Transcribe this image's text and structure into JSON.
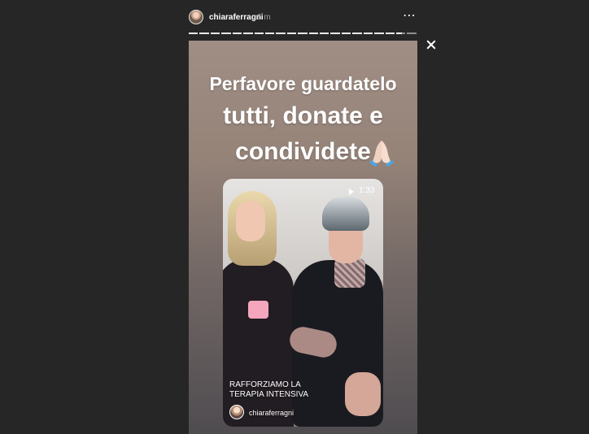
{
  "header": {
    "username": "chiaraferragni",
    "time": "6 m"
  },
  "story": {
    "caption": {
      "line1": "Perfavore guardatelo",
      "line2": "tutti, donate e",
      "line3": "condividete"
    },
    "video": {
      "duration": "1:33",
      "title_line1": "RAFFORZIAMO LA",
      "title_line2": "TERAPIA INTENSIVA",
      "username": "chiaraferragni"
    }
  },
  "icons": {
    "menu": "more-icon",
    "close": "close-icon",
    "reaction": "folded-hands-icon",
    "play": "play-icon"
  },
  "progress": {
    "segments": 21,
    "current_segment": 20,
    "current_fraction": 0.65
  }
}
